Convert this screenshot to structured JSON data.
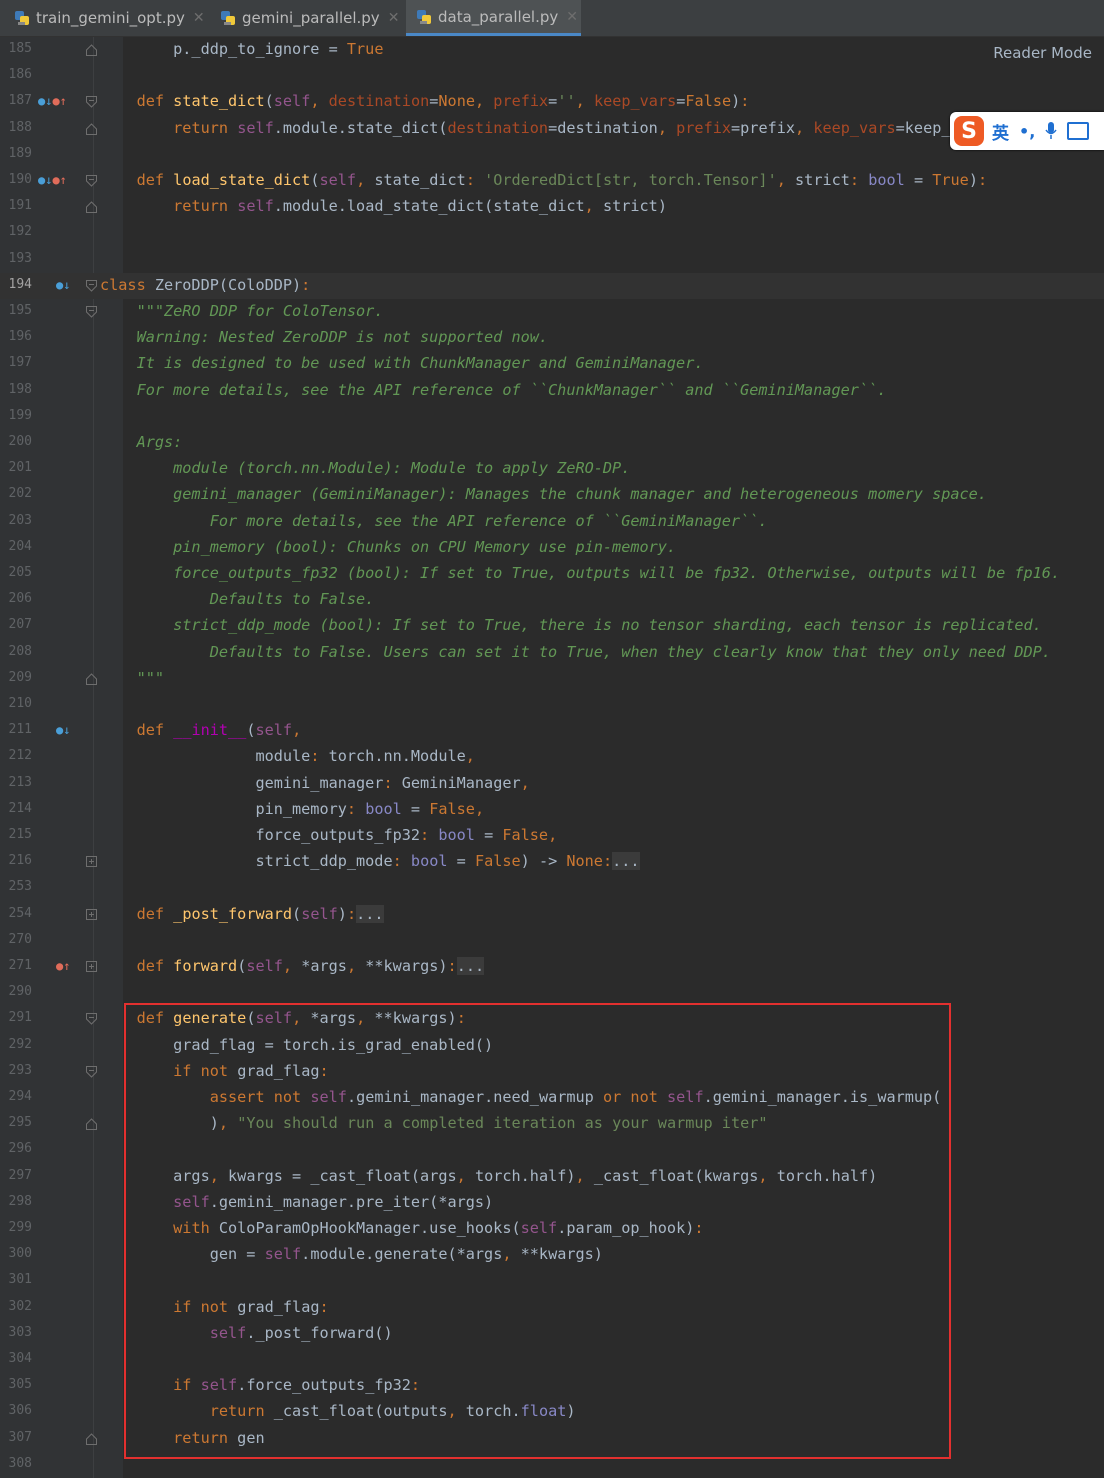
{
  "tabs": [
    {
      "label": "train_gemini_opt.py",
      "active": false
    },
    {
      "label": "gemini_parallel.py",
      "active": false
    },
    {
      "label": "data_parallel.py",
      "active": true
    }
  ],
  "reader_mode": "Reader Mode",
  "ime": {
    "logo": "S",
    "lang": "英",
    "punct": "•,"
  },
  "colors": {
    "keyword": "#cc7832",
    "self": "#94558d",
    "function": "#ffc66d",
    "string": "#6a8759",
    "docstring": "#629755",
    "highlight_box": "#e3302f",
    "tab_underline": "#4a88c7"
  },
  "current_line": "194",
  "lines": [
    {
      "n": "185",
      "text": "        p._ddp_to_ignore = True"
    },
    {
      "n": "186",
      "text": ""
    },
    {
      "n": "187",
      "text": "    def state_dict(self, destination=None, prefix='', keep_vars=False):"
    },
    {
      "n": "188",
      "text": "        return self.module.state_dict(destination=destination, prefix=prefix, keep_vars=keep_va"
    },
    {
      "n": "189",
      "text": ""
    },
    {
      "n": "190",
      "text": "    def load_state_dict(self, state_dict: 'OrderedDict[str, torch.Tensor]', strict: bool = True):"
    },
    {
      "n": "191",
      "text": "        return self.module.load_state_dict(state_dict, strict)"
    },
    {
      "n": "192",
      "text": ""
    },
    {
      "n": "193",
      "text": ""
    },
    {
      "n": "194",
      "text": "class ZeroDDP(ColoDDP):"
    },
    {
      "n": "195",
      "text": "    \"\"\"ZeRO DDP for ColoTensor."
    },
    {
      "n": "196",
      "text": "    Warning: Nested ZeroDDP is not supported now."
    },
    {
      "n": "197",
      "text": "    It is designed to be used with ChunkManager and GeminiManager."
    },
    {
      "n": "198",
      "text": "    For more details, see the API reference of ``ChunkManager`` and ``GeminiManager``."
    },
    {
      "n": "199",
      "text": ""
    },
    {
      "n": "200",
      "text": "    Args:"
    },
    {
      "n": "201",
      "text": "        module (torch.nn.Module): Module to apply ZeRO-DP."
    },
    {
      "n": "202",
      "text": "        gemini_manager (GeminiManager): Manages the chunk manager and heterogeneous momery space."
    },
    {
      "n": "203",
      "text": "            For more details, see the API reference of ``GeminiManager``."
    },
    {
      "n": "204",
      "text": "        pin_memory (bool): Chunks on CPU Memory use pin-memory."
    },
    {
      "n": "205",
      "text": "        force_outputs_fp32 (bool): If set to True, outputs will be fp32. Otherwise, outputs will be fp16."
    },
    {
      "n": "206",
      "text": "            Defaults to False."
    },
    {
      "n": "207",
      "text": "        strict_ddp_mode (bool): If set to True, there is no tensor sharding, each tensor is replicated."
    },
    {
      "n": "208",
      "text": "            Defaults to False. Users can set it to True, when they clearly know that they only need DDP."
    },
    {
      "n": "209",
      "text": "    \"\"\""
    },
    {
      "n": "210",
      "text": ""
    },
    {
      "n": "211",
      "text": "    def __init__(self,"
    },
    {
      "n": "212",
      "text": "                 module: torch.nn.Module,"
    },
    {
      "n": "213",
      "text": "                 gemini_manager: GeminiManager,"
    },
    {
      "n": "214",
      "text": "                 pin_memory: bool = False,"
    },
    {
      "n": "215",
      "text": "                 force_outputs_fp32: bool = False,"
    },
    {
      "n": "216",
      "text": "                 strict_ddp_mode: bool = False) -> None:..."
    },
    {
      "n": "253",
      "text": ""
    },
    {
      "n": "254",
      "text": "    def _post_forward(self):..."
    },
    {
      "n": "270",
      "text": ""
    },
    {
      "n": "271",
      "text": "    def forward(self, *args, **kwargs):..."
    },
    {
      "n": "290",
      "text": ""
    },
    {
      "n": "291",
      "text": "    def generate(self, *args, **kwargs):"
    },
    {
      "n": "292",
      "text": "        grad_flag = torch.is_grad_enabled()"
    },
    {
      "n": "293",
      "text": "        if not grad_flag:"
    },
    {
      "n": "294",
      "text": "            assert not self.gemini_manager.need_warmup or not self.gemini_manager.is_warmup("
    },
    {
      "n": "295",
      "text": "            ), \"You should run a completed iteration as your warmup iter\""
    },
    {
      "n": "296",
      "text": ""
    },
    {
      "n": "297",
      "text": "        args, kwargs = _cast_float(args, torch.half), _cast_float(kwargs, torch.half)"
    },
    {
      "n": "298",
      "text": "        self.gemini_manager.pre_iter(*args)"
    },
    {
      "n": "299",
      "text": "        with ColoParamOpHookManager.use_hooks(self.param_op_hook):"
    },
    {
      "n": "300",
      "text": "            gen = self.module.generate(*args, **kwargs)"
    },
    {
      "n": "301",
      "text": ""
    },
    {
      "n": "302",
      "text": "        if not grad_flag:"
    },
    {
      "n": "303",
      "text": "            self._post_forward()"
    },
    {
      "n": "304",
      "text": ""
    },
    {
      "n": "305",
      "text": "        if self.force_outputs_fp32:"
    },
    {
      "n": "306",
      "text": "            return _cast_float(outputs, torch.float)"
    },
    {
      "n": "307",
      "text": "        return gen"
    },
    {
      "n": "308",
      "text": ""
    }
  ]
}
